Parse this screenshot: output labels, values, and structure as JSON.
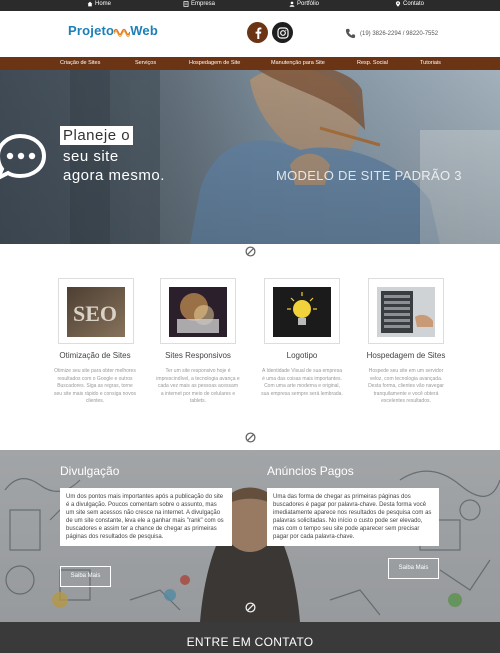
{
  "topbar": {
    "home": "Home",
    "empresa": "Empresa",
    "portfolio": "Portfólio",
    "contato": "Contato"
  },
  "header": {
    "logo_part1": "Projeto",
    "logo_part2": "Web",
    "phone": "(19) 3826-2294 / 98220-7552"
  },
  "nav": {
    "items": [
      "Criação de Sites",
      "Serviços",
      "Hospedagem de Site",
      "Manutenção para Site",
      "Resp. Social",
      "Tutoriais"
    ]
  },
  "hero": {
    "line1": "Planeje o",
    "line2": "seu site",
    "line3": "agora mesmo.",
    "side_text": "MODELO DE SITE PADRÃO 3"
  },
  "services": [
    {
      "title": "Otimização de Sites",
      "desc": "Otimize seu site para obter melhores resultados com o Google e outros Buscadores. Siga as regras, torne seu site mais rápido e consiga novos clientes."
    },
    {
      "title": "Sites Responsivos",
      "desc": "Ter um site responsivo hoje é imprescindível, a tecnologia avança e cada vez mais as pessoas acessam a internet por meio de celulares e tablets."
    },
    {
      "title": "Logotipo",
      "desc": "A Identidade Visual de sua empresa é uma das coisas mais importantes. Com uma arte moderna e original, sua empresa sempre será lembrada."
    },
    {
      "title": "Hospedagem de Sites",
      "desc": "Hospede seu site em um servidor veloz, com tecnologia avançada. Desta forma, clientes vão navegar tranquilamente e você obterá excelentes resultados."
    }
  ],
  "banner": {
    "left_title": "Divulgação",
    "left_text": "Um dos pontos mais importantes após a publicação do site é a divulgação. Poucos comentam sobre o assunto, mas um site sem acessos não cresce na internet. A divulgação de um site constante, leva ele a ganhar mais \"rank\" com os buscadores e assim ter a chance de chegar as primeiras páginas dos resultados de pesquisa.",
    "left_button": "Saiba Mais",
    "right_title": "Anúncios Pagos",
    "right_text": "Uma das forma de chegar as primeiras páginas dos buscadores é pagar por palavra-chave. Desta forma você imediatamente aparece nos resultados de pesquisa com as palavras solicitadas. No início o custo pode ser elevado, mas com o tempo seu site pode aparecer sem precisar pagar por cada palavra-chave.",
    "right_button": "Saiba Mais"
  },
  "footer": {
    "title": "ENTRE EM CONTATO"
  },
  "colors": {
    "brand_brown": "#6b3414",
    "topbar": "#2b2b2b",
    "logo_blue": "#1b7fb8",
    "footer": "#3a3a3a"
  },
  "icons": [
    "home-icon",
    "building-icon",
    "user-icon",
    "location-pin-icon",
    "facebook-icon",
    "instagram-icon",
    "phone-icon",
    "chat-bubble-icon",
    "no-entry-icon"
  ]
}
